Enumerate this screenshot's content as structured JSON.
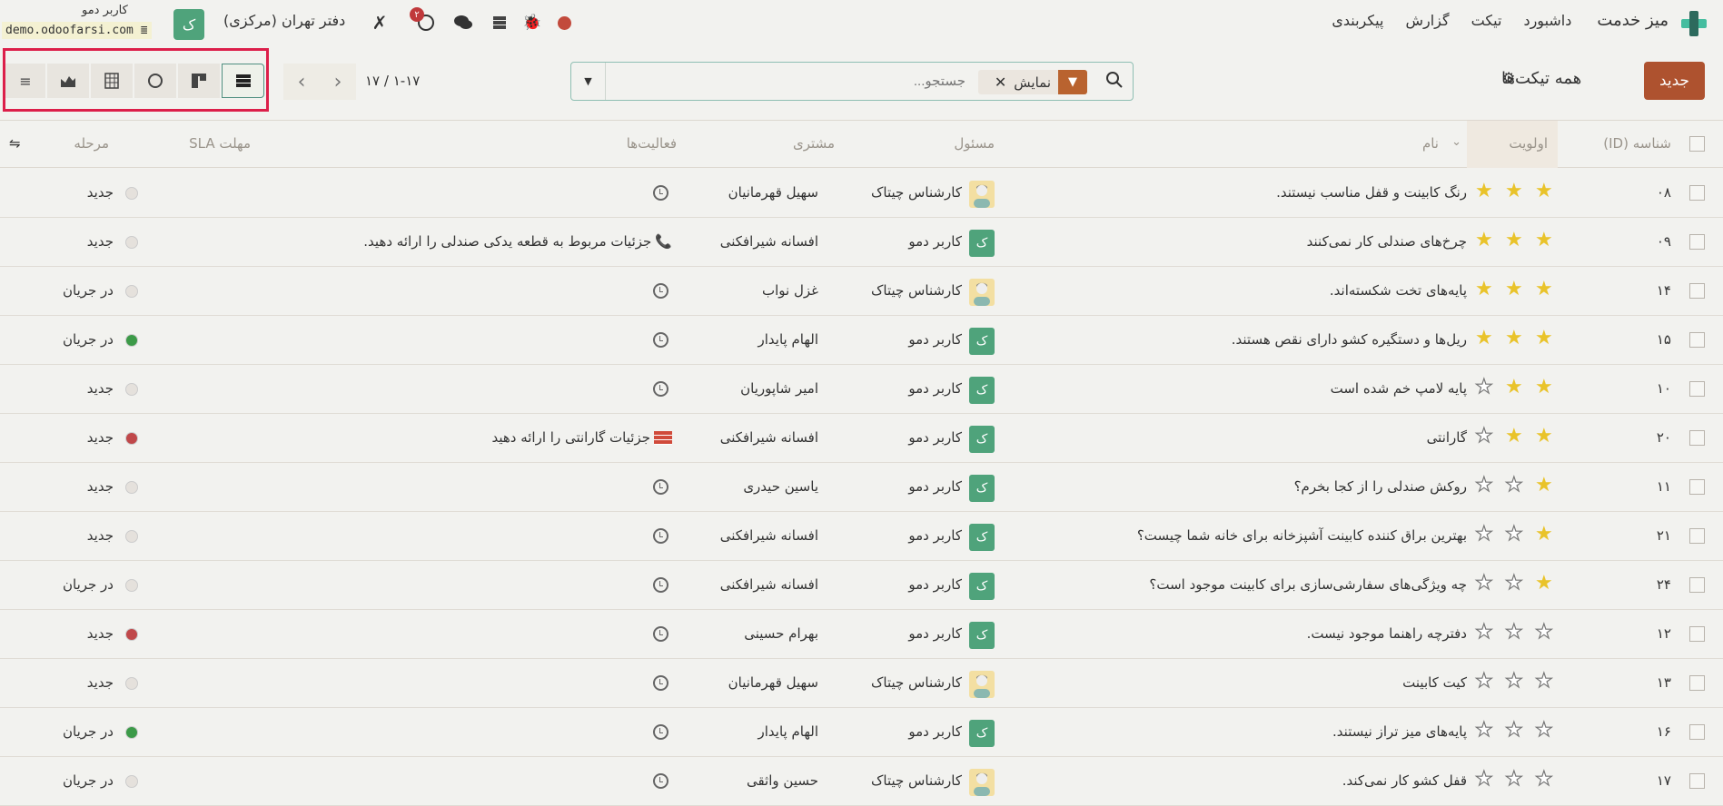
{
  "topbar": {
    "app_name": "میز خدمت",
    "menu": [
      "داشبورد",
      "تیکت",
      "گزارش",
      "پیکربندی"
    ],
    "company": "دفتر تهران (مرکزی)",
    "user_name": "کاربر دمو",
    "db_name": "demo.odoofarsi.com",
    "avatar_letter": "ک",
    "activity_count": "۲"
  },
  "control": {
    "new_label": "جدید",
    "title": "همه تیکت‌ها",
    "search_placeholder": "جستجو...",
    "facet_label": "نمایش",
    "pager": "۱-۱۷ / ۱۷"
  },
  "columns": {
    "id": "شناسه (ID)",
    "priority": "اولویت",
    "name": "نام",
    "responsible": "مسئول",
    "customer": "مشتری",
    "activities": "فعالیت‌ها",
    "sla": "مهلت SLA",
    "stage": "مرحله"
  },
  "colors": {
    "accent": "#ae522f",
    "star": "#e9c32a",
    "green": "#3c9a48",
    "red": "#c0484a",
    "grey": "#e5e1dc"
  },
  "rows": [
    {
      "id": "۰۸",
      "priority": 3,
      "name": "رنگ کابینت و قفل مناسب نیستند.",
      "resp": "کارشناس چیتاک",
      "resp_type": "photo",
      "customer": "سهیل قهرمانیان",
      "activity": "",
      "activity_type": "clock",
      "kanban": "grey",
      "stage": "جدید"
    },
    {
      "id": "۰۹",
      "priority": 3,
      "name": "چرخ‌های صندلی کار نمی‌کنند",
      "resp": "کاربر دمو",
      "resp_type": "letter",
      "customer": "افسانه شیرافکنی",
      "activity": "جزئیات مربوط به قطعه یدکی صندلی را ارائه دهید.",
      "activity_type": "phone",
      "kanban": "grey",
      "stage": "جدید"
    },
    {
      "id": "۱۴",
      "priority": 3,
      "name": "پایه‌های تخت شکسته‌اند.",
      "resp": "کارشناس چیتاک",
      "resp_type": "photo",
      "customer": "غزل نواب",
      "activity": "",
      "activity_type": "clock",
      "kanban": "grey",
      "stage": "در جریان"
    },
    {
      "id": "۱۵",
      "priority": 3,
      "name": "ریل‌ها و دستگیره کشو دارای نقص هستند.",
      "resp": "کاربر دمو",
      "resp_type": "letter",
      "customer": "الهام پایدار",
      "activity": "",
      "activity_type": "clock",
      "kanban": "green",
      "stage": "در جریان"
    },
    {
      "id": "۱۰",
      "priority": 2,
      "name": "پایه لامپ خم شده است",
      "resp": "کاربر دمو",
      "resp_type": "letter",
      "customer": "امیر شاپوریان",
      "activity": "",
      "activity_type": "clock",
      "kanban": "grey",
      "stage": "جدید"
    },
    {
      "id": "۲۰",
      "priority": 2,
      "name": "گارانتی",
      "resp": "کاربر دمو",
      "resp_type": "letter",
      "customer": "افسانه شیرافکنی",
      "activity": "جزئیات گارانتی را ارائه دهید",
      "activity_type": "list",
      "kanban": "red",
      "stage": "جدید"
    },
    {
      "id": "۱۱",
      "priority": 1,
      "name": "روکش صندلی را از کجا بخرم؟",
      "resp": "کاربر دمو",
      "resp_type": "letter",
      "customer": "یاسین حیدری",
      "activity": "",
      "activity_type": "clock",
      "kanban": "grey",
      "stage": "جدید"
    },
    {
      "id": "۲۱",
      "priority": 1,
      "name": "بهترین براق کننده کابینت آشپزخانه برای خانه شما چیست؟",
      "resp": "کاربر دمو",
      "resp_type": "letter",
      "customer": "افسانه شیرافکنی",
      "activity": "",
      "activity_type": "clock",
      "kanban": "grey",
      "stage": "جدید"
    },
    {
      "id": "۲۴",
      "priority": 1,
      "name": "چه ویژگی‌های سفارشی‌سازی برای کابینت موجود است؟",
      "resp": "کاربر دمو",
      "resp_type": "letter",
      "customer": "افسانه شیرافکنی",
      "activity": "",
      "activity_type": "clock",
      "kanban": "grey",
      "stage": "در جریان"
    },
    {
      "id": "۱۲",
      "priority": 0,
      "name": "دفترچه راهنما موجود نیست.",
      "resp": "کاربر دمو",
      "resp_type": "letter",
      "customer": "بهرام حسینی",
      "activity": "",
      "activity_type": "clock",
      "kanban": "red",
      "stage": "جدید"
    },
    {
      "id": "۱۳",
      "priority": 0,
      "name": "کیت کابینت",
      "resp": "کارشناس چیتاک",
      "resp_type": "photo",
      "customer": "سهیل قهرمانیان",
      "activity": "",
      "activity_type": "clock",
      "kanban": "grey",
      "stage": "جدید"
    },
    {
      "id": "۱۶",
      "priority": 0,
      "name": "پایه‌های میز تراز نیستند.",
      "resp": "کاربر دمو",
      "resp_type": "letter",
      "customer": "الهام پایدار",
      "activity": "",
      "activity_type": "clock",
      "kanban": "green",
      "stage": "در جریان"
    },
    {
      "id": "۱۷",
      "priority": 0,
      "name": "قفل کشو کار نمی‌کند.",
      "resp": "کارشناس چیتاک",
      "resp_type": "photo",
      "customer": "حسین واثقی",
      "activity": "",
      "activity_type": "clock",
      "kanban": "grey",
      "stage": "در جریان"
    }
  ]
}
